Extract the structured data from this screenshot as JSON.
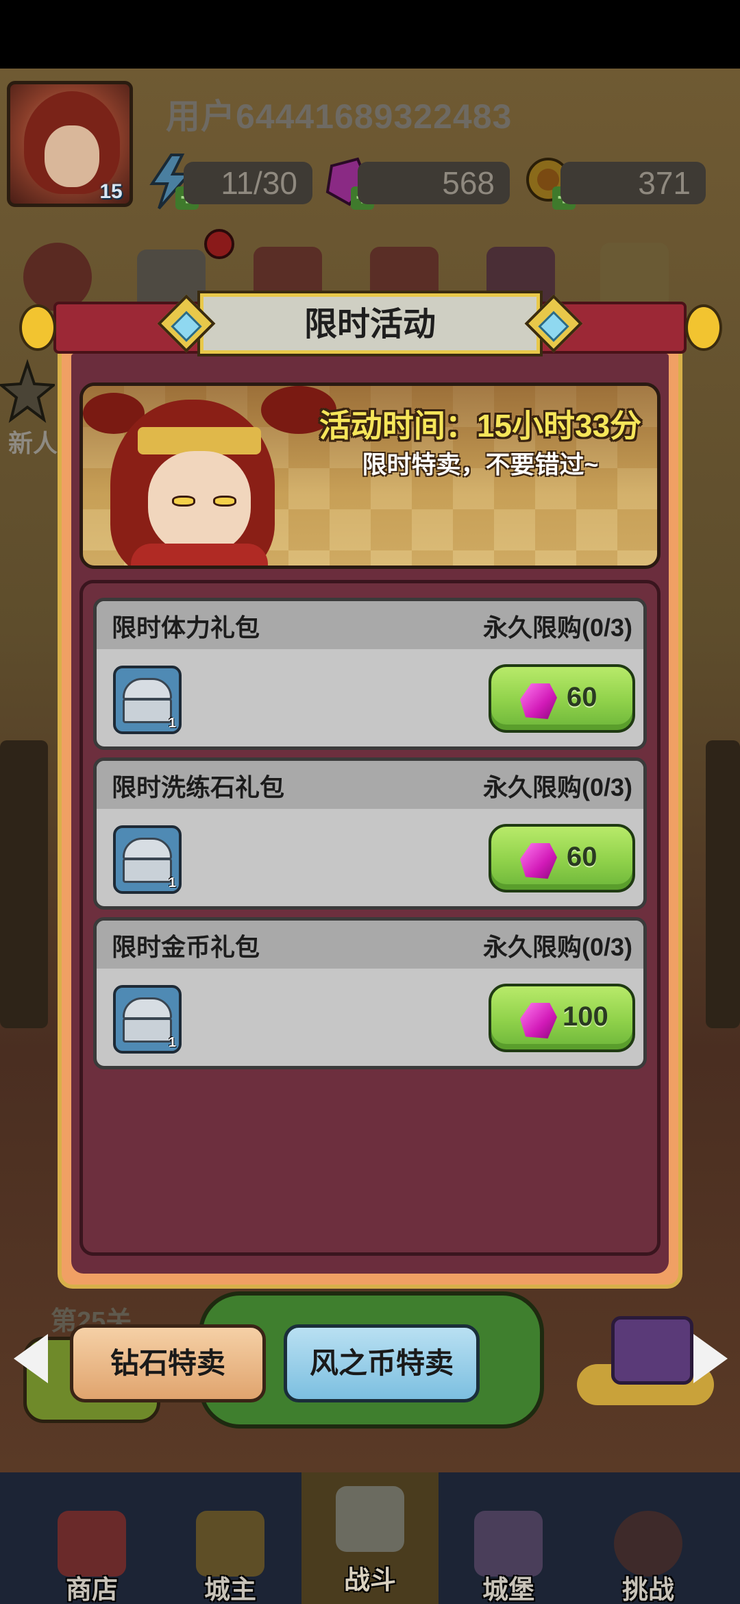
{
  "player": {
    "username": "用户64441689322483",
    "level": "15"
  },
  "resources": {
    "stamina": "11/30",
    "gems": "568",
    "coins": "371"
  },
  "side": {
    "newbie_label": "新人"
  },
  "modal": {
    "title": "限时活动",
    "banner_time": "活动时间：15小时33分",
    "banner_subtitle": "限时特卖，不要错过~",
    "packages": [
      {
        "name": "限时体力礼包",
        "limit": "永久限购(0/3)",
        "item_qty": "1",
        "price": "60"
      },
      {
        "name": "限时洗练石礼包",
        "limit": "永久限购(0/3)",
        "item_qty": "1",
        "price": "60"
      },
      {
        "name": "限时金币礼包",
        "limit": "永久限购(0/3)",
        "item_qty": "1",
        "price": "100"
      }
    ]
  },
  "stage": {
    "label": "第25关"
  },
  "sale_tabs": {
    "diamond": "钻石特卖",
    "wind_coin": "风之币特卖"
  },
  "nav": {
    "items": [
      {
        "label": "商店"
      },
      {
        "label": "城主"
      },
      {
        "label": "战斗"
      },
      {
        "label": "城堡"
      },
      {
        "label": "挑战"
      }
    ],
    "active_index": 2
  },
  "colors": {
    "modal_header": "#9c2836",
    "modal_frame": "#f0a064",
    "buy_button": "#8fd14a",
    "gem": "#d21ab8"
  }
}
